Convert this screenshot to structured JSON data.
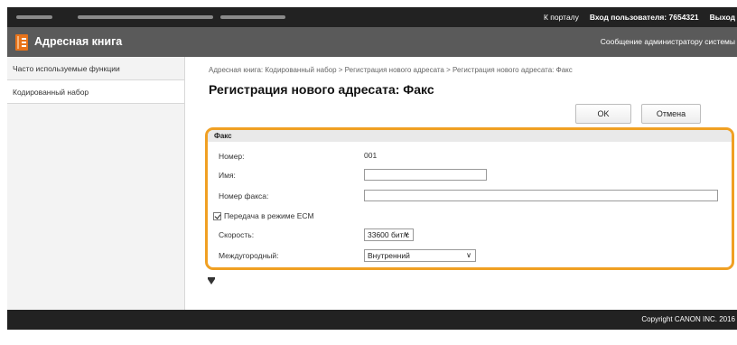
{
  "header": {
    "portal_link": "К порталу",
    "login_label": "Вход пользователя:",
    "login_user": "7654321",
    "logout_link": "Выход"
  },
  "titlebar": {
    "app_title": "Адресная книга",
    "app_icon": "address-book-icon",
    "admin_message": "Сообщение администратору системы"
  },
  "sidebar": {
    "items": [
      {
        "label": "Часто используемые функции"
      },
      {
        "label": "Кодированный набор"
      }
    ]
  },
  "main": {
    "breadcrumb": "Адресная книга: Кодированный набор > Регистрация нового адресата > Регистрация нового адресата: Факс",
    "title": "Регистрация нового адресата: Факс",
    "ok_button": "OK",
    "cancel_button": "Отмена"
  },
  "fax_form": {
    "section_title": "Факс",
    "number_label": "Номер:",
    "number_value": "001",
    "name_label": "Имя:",
    "name_value": "",
    "fax_number_label": "Номер факса:",
    "fax_number_value": "",
    "ecm_label": "Передача в режиме ECM",
    "ecm_checked": true,
    "speed_label": "Скорость:",
    "speed_value": "33600 бит/с",
    "long_distance_label": "Междугородный:",
    "long_distance_value": "Внутренний"
  },
  "footer": {
    "copyright": "Copyright CANON INC. 2016"
  },
  "colors": {
    "accent_orange": "#f0a023",
    "topbar": "#222222",
    "titlebar": "#5a5a5a",
    "icon_orange": "#e8731a"
  }
}
